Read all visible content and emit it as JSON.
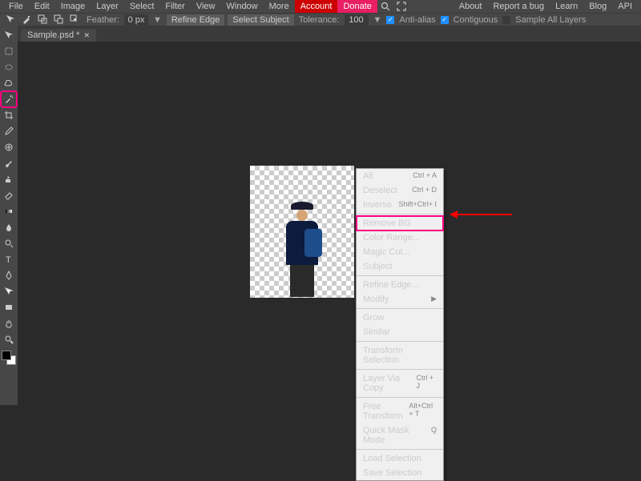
{
  "menubar": {
    "items": [
      "File",
      "Edit",
      "Image",
      "Layer",
      "Select",
      "Filter",
      "View",
      "Window",
      "More"
    ],
    "account": "Account",
    "donate": "Donate",
    "right": [
      "About",
      "Report a bug",
      "Learn",
      "Blog",
      "API"
    ]
  },
  "options": {
    "feather_label": "Feather:",
    "feather_value": "0 px",
    "refine_edge": "Refine Edge",
    "select_subject": "Select Subject",
    "tolerance_label": "Tolerance:",
    "tolerance_value": "100",
    "anti_alias": "Anti-alias",
    "contiguous": "Contiguous",
    "sample_all": "Sample All Layers"
  },
  "tab": {
    "title": "Sample.psd *"
  },
  "tools": [
    {
      "name": "move-tool"
    },
    {
      "name": "rect-select-tool"
    },
    {
      "name": "ellipse-select-tool"
    },
    {
      "name": "lasso-tool"
    },
    {
      "name": "magic-wand-tool",
      "active": true
    },
    {
      "name": "crop-tool"
    },
    {
      "name": "eyedropper-tool"
    },
    {
      "name": "healing-tool"
    },
    {
      "name": "brush-tool"
    },
    {
      "name": "clone-tool"
    },
    {
      "name": "eraser-tool"
    },
    {
      "name": "gradient-tool"
    },
    {
      "name": "blur-tool"
    },
    {
      "name": "dodge-tool"
    },
    {
      "name": "type-tool"
    },
    {
      "name": "pen-tool"
    },
    {
      "name": "path-select-tool"
    },
    {
      "name": "rectangle-tool"
    },
    {
      "name": "hand-tool"
    },
    {
      "name": "zoom-tool"
    }
  ],
  "context_menu": [
    {
      "label": "All",
      "shortcut": "Ctrl + A"
    },
    {
      "label": "Deselect",
      "shortcut": "Ctrl + D",
      "disabled": true
    },
    {
      "label": "Inverse",
      "shortcut": "Shift+Ctrl+ I",
      "disabled": true
    },
    {
      "sep": true
    },
    {
      "label": "Remove BG",
      "highlighted": true
    },
    {
      "label": "Color Range..."
    },
    {
      "label": "Magic Cut..."
    },
    {
      "label": "Subject"
    },
    {
      "sep": true
    },
    {
      "label": "Refine Edge..."
    },
    {
      "label": "Modify",
      "sub": true
    },
    {
      "sep": true
    },
    {
      "label": "Grow",
      "disabled": true
    },
    {
      "label": "Similar",
      "disabled": true
    },
    {
      "sep": true
    },
    {
      "label": "Transform Selection",
      "disabled": true
    },
    {
      "sep": true
    },
    {
      "label": "Layer Via Copy",
      "shortcut": "Ctrl + J"
    },
    {
      "sep": true
    },
    {
      "label": "Free Transform",
      "shortcut": "Alt+Ctrl + T"
    },
    {
      "label": "Quick Mask Mode",
      "shortcut": "Q"
    },
    {
      "sep": true
    },
    {
      "label": "Load Selection"
    },
    {
      "label": "Save Selection",
      "disabled": true
    }
  ]
}
